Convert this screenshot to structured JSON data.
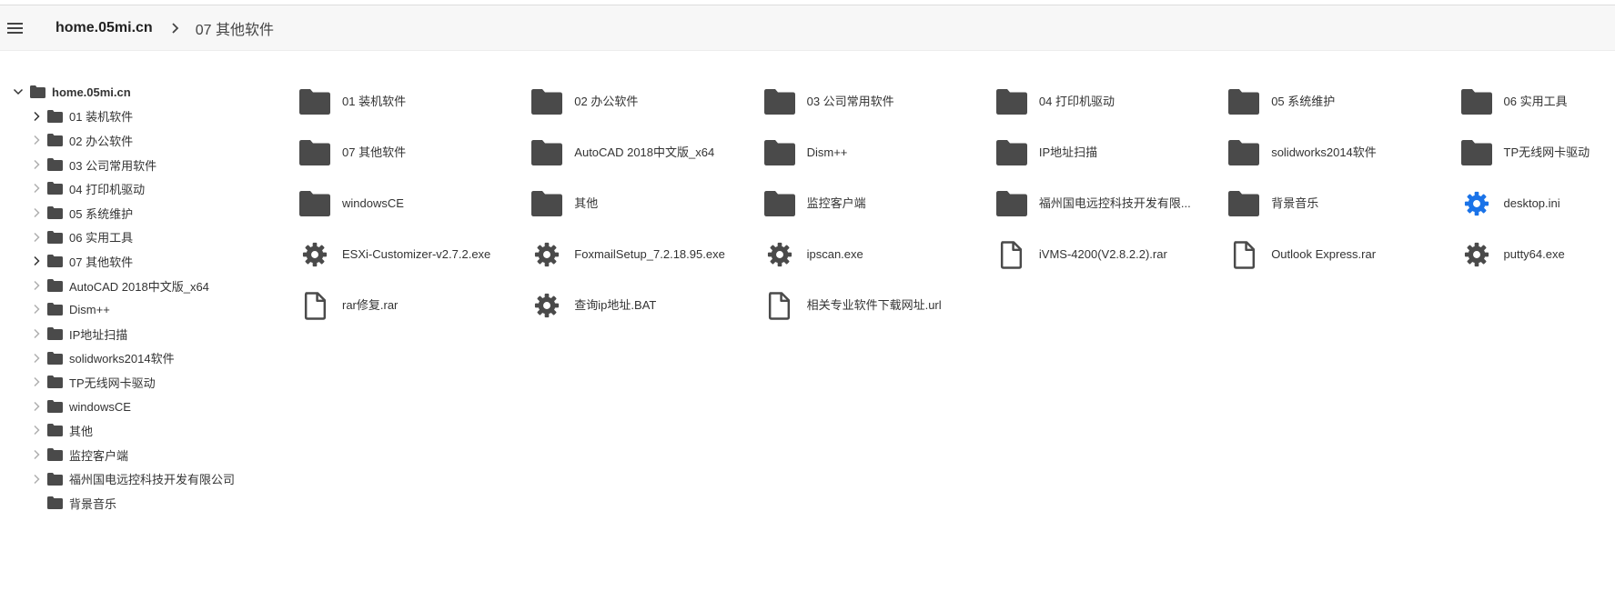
{
  "header": {
    "root_label": "home.05mi.cn",
    "current_label": "07 其他软件"
  },
  "tree": {
    "root": "home.05mi.cn",
    "items": [
      {
        "label": "01 装机软件",
        "expandable": true,
        "chevron": "dark"
      },
      {
        "label": "02 办公软件",
        "expandable": true,
        "chevron": "light"
      },
      {
        "label": "03 公司常用软件",
        "expandable": true,
        "chevron": "light"
      },
      {
        "label": "04 打印机驱动",
        "expandable": true,
        "chevron": "light"
      },
      {
        "label": "05 系统维护",
        "expandable": true,
        "chevron": "light"
      },
      {
        "label": "06 实用工具",
        "expandable": true,
        "chevron": "light"
      },
      {
        "label": "07 其他软件",
        "expandable": true,
        "chevron": "dark"
      },
      {
        "label": "AutoCAD 2018中文版_x64",
        "expandable": true,
        "chevron": "light"
      },
      {
        "label": "Dism++",
        "expandable": true,
        "chevron": "light"
      },
      {
        "label": "IP地址扫描",
        "expandable": true,
        "chevron": "light"
      },
      {
        "label": "solidworks2014软件",
        "expandable": true,
        "chevron": "light"
      },
      {
        "label": "TP无线网卡驱动",
        "expandable": true,
        "chevron": "light"
      },
      {
        "label": "windowsCE",
        "expandable": true,
        "chevron": "light"
      },
      {
        "label": "其他",
        "expandable": true,
        "chevron": "light"
      },
      {
        "label": "监控客户端",
        "expandable": true,
        "chevron": "light"
      },
      {
        "label": "福州国电远控科技开发有限公司",
        "expandable": true,
        "chevron": "light"
      },
      {
        "label": "背景音乐",
        "expandable": false,
        "chevron": "none"
      }
    ]
  },
  "grid": {
    "items": [
      {
        "name": "01 装机软件",
        "icon": "folder-icon"
      },
      {
        "name": "02 办公软件",
        "icon": "folder-icon"
      },
      {
        "name": "03 公司常用软件",
        "icon": "folder-icon"
      },
      {
        "name": "04 打印机驱动",
        "icon": "folder-icon"
      },
      {
        "name": "05 系统维护",
        "icon": "folder-icon"
      },
      {
        "name": "06 实用工具",
        "icon": "folder-icon"
      },
      {
        "name": "07 其他软件",
        "icon": "folder-icon"
      },
      {
        "name": "AutoCAD 2018中文版_x64",
        "icon": "folder-icon"
      },
      {
        "name": "Dism++",
        "icon": "folder-icon"
      },
      {
        "name": "IP地址扫描",
        "icon": "folder-icon"
      },
      {
        "name": "solidworks2014软件",
        "icon": "folder-icon"
      },
      {
        "name": "TP无线网卡驱动",
        "icon": "folder-icon"
      },
      {
        "name": "windowsCE",
        "icon": "folder-icon"
      },
      {
        "name": "其他",
        "icon": "folder-icon"
      },
      {
        "name": "监控客户端",
        "icon": "folder-icon"
      },
      {
        "name": "福州国电远控科技开发有限...",
        "icon": "folder-icon"
      },
      {
        "name": "背景音乐",
        "icon": "folder-icon"
      },
      {
        "name": "desktop.ini",
        "icon": "gear-icon",
        "color": "#1a73e8"
      },
      {
        "name": "ESXi-Customizer-v2.7.2.exe",
        "icon": "gear-icon"
      },
      {
        "name": "FoxmailSetup_7.2.18.95.exe",
        "icon": "gear-icon"
      },
      {
        "name": "ipscan.exe",
        "icon": "gear-icon"
      },
      {
        "name": "iVMS-4200(V2.8.2.2).rar",
        "icon": "file-icon"
      },
      {
        "name": "Outlook Express.rar",
        "icon": "file-icon"
      },
      {
        "name": "putty64.exe",
        "icon": "gear-icon"
      },
      {
        "name": "rar修复.rar",
        "icon": "file-icon"
      },
      {
        "name": "查询ip地址.BAT",
        "icon": "gear-icon"
      },
      {
        "name": "相关专业软件下载网址.url",
        "icon": "file-icon"
      }
    ]
  },
  "colors": {
    "icon": "#4a4a4a",
    "accent": "#1a73e8",
    "header_bg": "#f7f7f7"
  }
}
